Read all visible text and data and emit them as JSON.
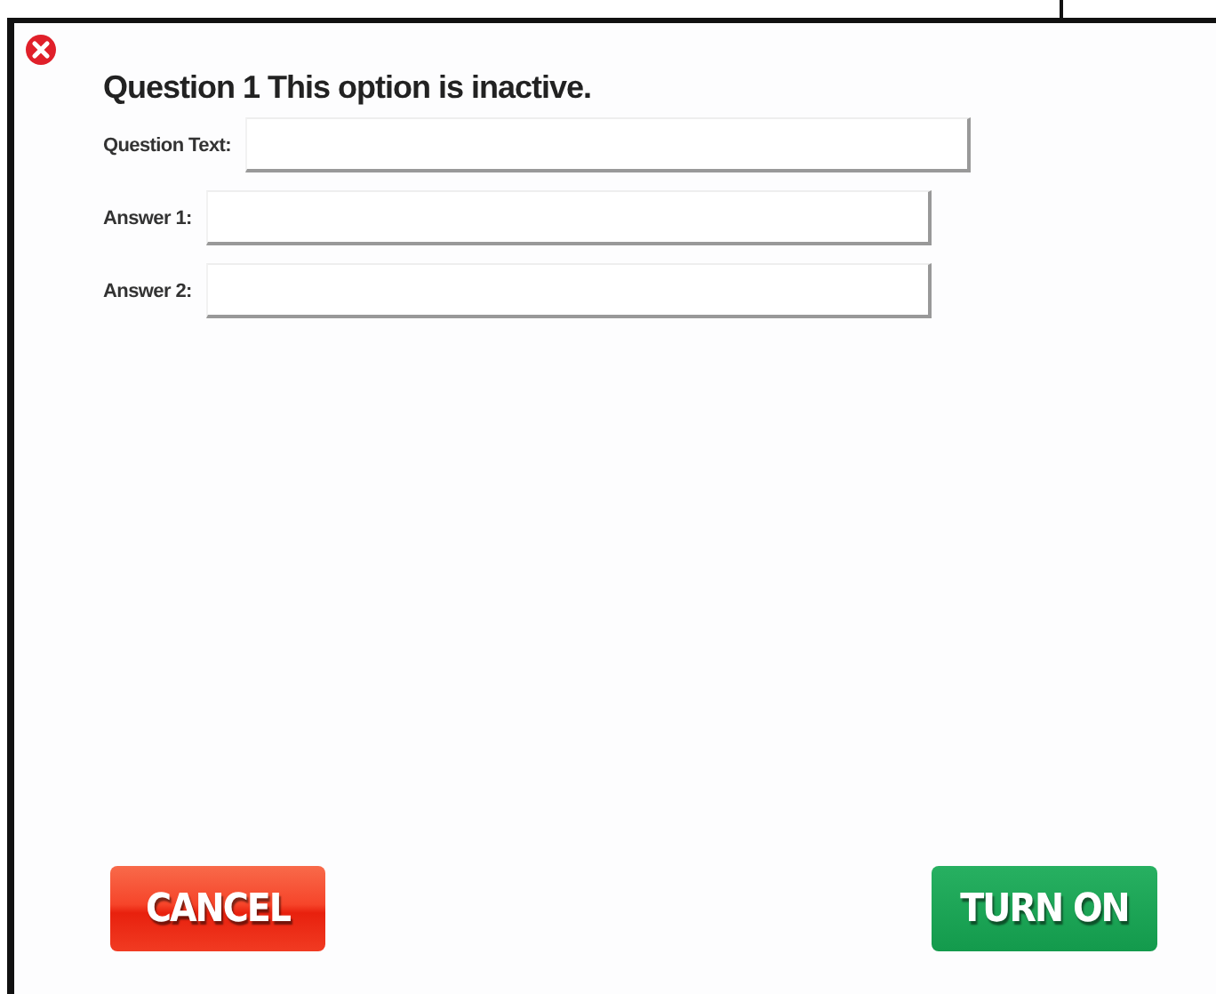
{
  "dialog": {
    "title": "Question 1 This option is inactive.",
    "fields": [
      {
        "label": "Question Text:"
      },
      {
        "label": "Answer 1:"
      },
      {
        "label": "Answer 2:"
      }
    ],
    "buttons": [
      {
        "label": "CANCEL",
        "kind": "cancel"
      },
      {
        "label": "TURN ON",
        "kind": "confirm"
      }
    ]
  }
}
